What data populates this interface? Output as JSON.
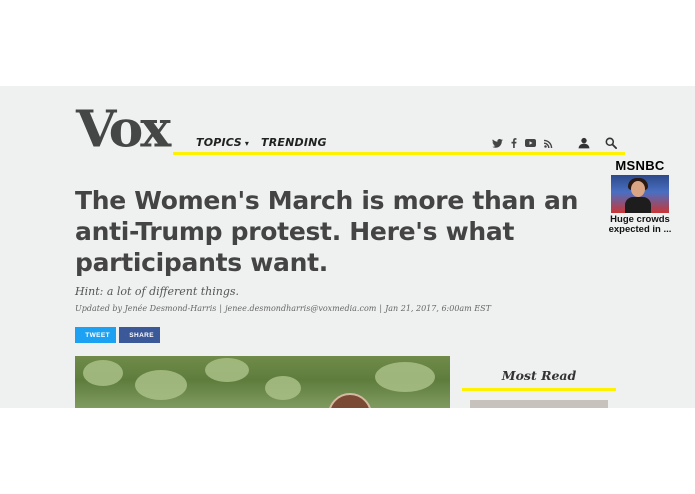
{
  "site": {
    "logo": "Vox"
  },
  "nav": {
    "topics": "TOPICS",
    "trending": "TRENDING"
  },
  "social_icons": [
    "twitter-icon",
    "facebook-icon",
    "youtube-icon",
    "rss-icon"
  ],
  "utility_icons": [
    "user-icon",
    "search-icon"
  ],
  "ad": {
    "brand": "MSNBC",
    "caption": "Huge crowds expected in ..."
  },
  "article": {
    "headline": "The Women's March is more than an anti-Trump protest. Here's what participants want.",
    "dek": "Hint: a lot of different things.",
    "byline": {
      "prefix": "Updated by",
      "author": "Jenée Desmond-Harris",
      "email": "jenee.desmondharris@voxmedia.com",
      "date": "Jan 21, 2017, 6:00am EST"
    },
    "share": {
      "tweet": "TWEET",
      "facebook": "SHARE"
    }
  },
  "sidebar": {
    "most_read_title": "Most Read"
  },
  "colors": {
    "accent_yellow": "#fff200",
    "twitter": "#1da1f2",
    "facebook": "#3b5998",
    "page_bg": "#eff0f0"
  }
}
